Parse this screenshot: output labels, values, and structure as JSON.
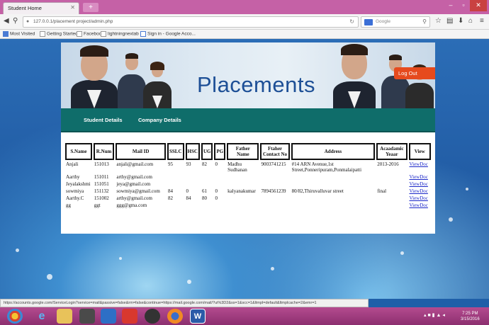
{
  "browser": {
    "tab_title": "Student Home",
    "new_tab": "+",
    "window_controls": {
      "minimize": "–",
      "maximize": "▫",
      "close": "✕"
    },
    "url": "127.0.0.1/placement project/admin.php",
    "search_placeholder": "Google",
    "bookmarks": [
      "Most Visited",
      "Getting Started",
      "Facebook",
      "lightningnextab",
      "Sign in - Google Acco..."
    ],
    "status_text": "https://accounts.google.com/ServiceLogin?service=mail&passive=false&rm=false&continue=https://mail.google.com/mail/?ui%3D2&ss=1&scc=1&ltmpl=default&ltmplcache=2&emr=1"
  },
  "site": {
    "banner_title": "Placements",
    "logout_label": "Log Out",
    "menu": [
      "Student Details",
      "Company Details"
    ]
  },
  "table": {
    "headers": [
      "S.Name",
      "R.Num",
      "Mail ID",
      "SSLC",
      "HSC",
      "UG",
      "PG",
      "Father Name",
      "Ftaher Contact No",
      "Address",
      "Acaadamic Yeaar",
      "View"
    ],
    "rows": [
      [
        "Anjali",
        "151013",
        "anjali@gmail.com",
        "95",
        "93",
        "82",
        "0",
        "Madhu Sudhanan",
        "9003741215",
        "#14 ARN Avenue,1st Street,Ponneripuram,Ponmalaipatti",
        "2013-2016",
        "ViewDoc"
      ],
      [
        "Aarthy",
        "151011",
        "arthy@gmail.com",
        "",
        "",
        "",
        "",
        "",
        "",
        "",
        "",
        "ViewDoc"
      ],
      [
        "Jeyalakshmi",
        "151051",
        "jeya@gmail.com",
        "",
        "",
        "",
        "",
        "",
        "",
        "",
        "",
        "ViewDoc"
      ],
      [
        "sowmiya",
        "151132",
        "sowmiya@gmail.com",
        "84",
        "0",
        "61",
        "0",
        "kalyanakumar",
        "7894561239",
        "80/82,Thiruvalluvar street",
        "final",
        "ViewDoc"
      ],
      [
        "Aarthy.C",
        "151002",
        "arthy@gmail.com",
        "82",
        "84",
        "80",
        "0",
        "",
        "",
        "",
        "",
        "ViewDoc"
      ],
      [
        "gg",
        "ggt",
        "ggg@gma.com",
        "",
        "",
        "",
        "",
        "",
        "",
        "",
        "",
        "ViewDoc"
      ]
    ]
  },
  "taskbar": {
    "clock_time": "7:25 PM",
    "clock_date": "3/15/2016"
  }
}
